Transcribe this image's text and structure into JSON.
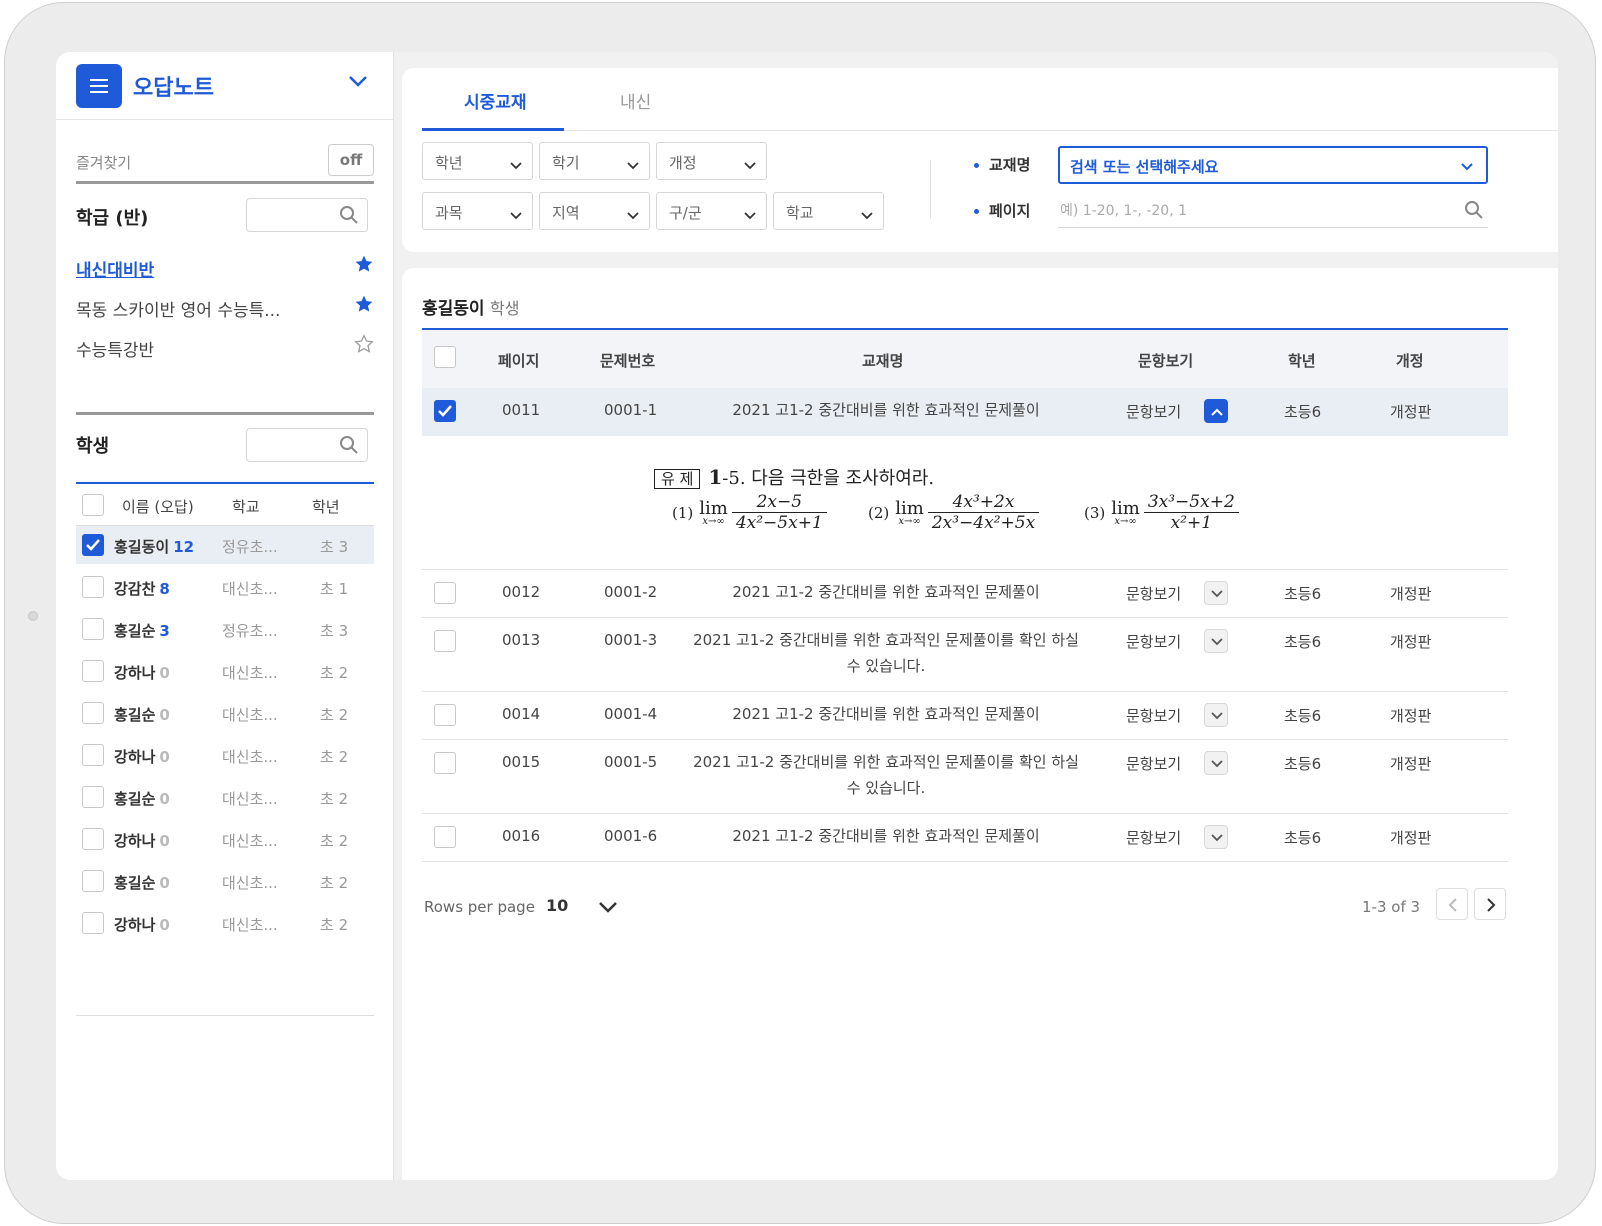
{
  "sidebar": {
    "app_title": "오답노트",
    "favorites_label": "즐겨찾기",
    "favorites_toggle": "off",
    "class_section_title": "학급 (반)",
    "classes": [
      {
        "label": "내신대비반",
        "starred": true,
        "active": true
      },
      {
        "label": "목동 스카이반 영어 수능특...",
        "starred": true,
        "active": false
      },
      {
        "label": "수능특강반",
        "starred": false,
        "active": false
      }
    ],
    "student_section_title": "학생",
    "student_columns": [
      "이름 (오답)",
      "학교",
      "학년"
    ],
    "students": [
      {
        "name": "홍길동이",
        "count": "12",
        "school": "정유초...",
        "grade": "초 3",
        "checked": true
      },
      {
        "name": "강감찬",
        "count": "8",
        "school": "대신초...",
        "grade": "초 1",
        "checked": false
      },
      {
        "name": "홍길순",
        "count": "3",
        "school": "정유초...",
        "grade": "초 3",
        "checked": false
      },
      {
        "name": "강하나",
        "count": "0",
        "school": "대신초...",
        "grade": "초 2",
        "checked": false
      },
      {
        "name": "홍길순",
        "count": "0",
        "school": "대신초...",
        "grade": "초 2",
        "checked": false
      },
      {
        "name": "강하나",
        "count": "0",
        "school": "대신초...",
        "grade": "초 2",
        "checked": false
      },
      {
        "name": "홍길순",
        "count": "0",
        "school": "대신초...",
        "grade": "초 2",
        "checked": false
      },
      {
        "name": "강하나",
        "count": "0",
        "school": "대신초...",
        "grade": "초 2",
        "checked": false
      },
      {
        "name": "홍길순",
        "count": "0",
        "school": "대신초...",
        "grade": "초 2",
        "checked": false
      },
      {
        "name": "강하나",
        "count": "0",
        "school": "대신초...",
        "grade": "초 2",
        "checked": false
      }
    ]
  },
  "tabs": [
    {
      "label": "시중교재",
      "active": true
    },
    {
      "label": "내신",
      "active": false
    }
  ],
  "filters": {
    "row1": [
      "학년",
      "학기",
      "개정"
    ],
    "row2": [
      "과목",
      "지역",
      "구/군",
      "학교"
    ],
    "book_label": "교재명",
    "book_value": "검색 또는 선택해주세요",
    "page_label": "페이지",
    "page_placeholder": "예) 1-20, 1-, -20, 1"
  },
  "table": {
    "student_name": "홍길동이",
    "student_suffix": "학생",
    "columns": [
      "페이지",
      "문제번호",
      "교재명",
      "문항보기",
      "학년",
      "개정"
    ],
    "rows": [
      {
        "page": "0011",
        "no": "0001-1",
        "book": "2021 고1-2 중간대비를 위한 효과적인 문제풀이",
        "view": "문항보기",
        "grade": "초등6",
        "rev": "개정판",
        "checked": true
      },
      {
        "page": "0012",
        "no": "0001-2",
        "book": "2021 고1-2 중간대비를 위한 효과적인 문제풀이",
        "view": "문항보기",
        "grade": "초등6",
        "rev": "개정판",
        "checked": false
      },
      {
        "page": "0013",
        "no": "0001-3",
        "book": "2021 고1-2 중간대비를 위한 효과적인 문제풀이를 확인 하실 수 있습니다.",
        "view": "문항보기",
        "grade": "초등6",
        "rev": "개정판",
        "checked": false
      },
      {
        "page": "0014",
        "no": "0001-4",
        "book": "2021 고1-2 중간대비를 위한 효과적인 문제풀이",
        "view": "문항보기",
        "grade": "초등6",
        "rev": "개정판",
        "checked": false
      },
      {
        "page": "0015",
        "no": "0001-5",
        "book": "2021 고1-2 중간대비를 위한 효과적인 문제풀이를 확인 하실 수 있습니다.",
        "view": "문항보기",
        "grade": "초등6",
        "rev": "개정판",
        "checked": false
      },
      {
        "page": "0016",
        "no": "0001-6",
        "book": "2021 고1-2 중간대비를 위한 효과적인 문제풀이",
        "view": "문항보기",
        "grade": "초등6",
        "rev": "개정판",
        "checked": false
      }
    ],
    "problem": {
      "tag": "유 제",
      "number": "1",
      "title": "-5. 다음 극한을 조사하여라.",
      "items": [
        {
          "label": "(1)",
          "lim": "lim",
          "sub": "x→∞",
          "num": "2x−5",
          "den": "4x²−5x+1"
        },
        {
          "label": "(2)",
          "lim": "lim",
          "sub": "x→∞",
          "num": "4x³+2x",
          "den": "2x³−4x²+5x"
        },
        {
          "label": "(3)",
          "lim": "lim",
          "sub": "x→∞",
          "num": "3x³−5x+2",
          "den": "x²+1"
        }
      ]
    }
  },
  "pagination": {
    "rows_per_page_label": "Rows per page",
    "rows_per_page_value": "10",
    "range": "1-3 of 3"
  },
  "colors": {
    "accent": "#1f5bd8",
    "selected_row": "#e9eef4"
  }
}
